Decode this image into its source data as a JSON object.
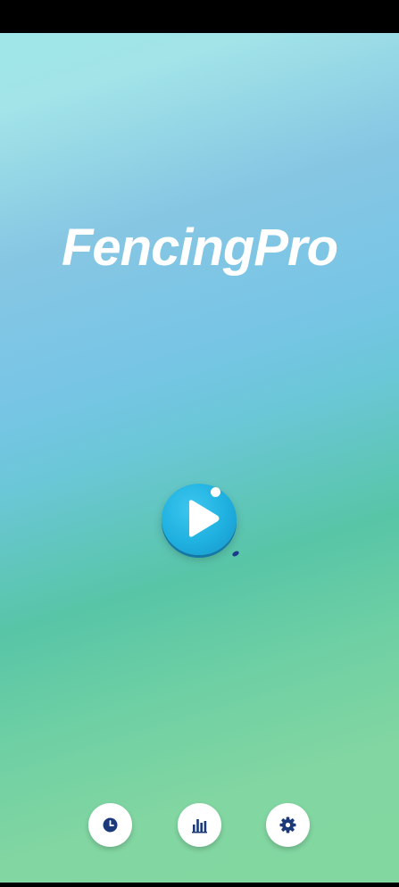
{
  "app": {
    "title": "FencingPro"
  },
  "main": {
    "play_icon": "play-icon"
  },
  "bottom_nav": {
    "items": [
      {
        "icon": "clock-icon"
      },
      {
        "icon": "bar-chart-icon"
      },
      {
        "icon": "gear-icon"
      }
    ]
  },
  "colors": {
    "play_button": "#1fb0e0",
    "nav_icon": "#1c3a7a",
    "title": "#ffffff"
  }
}
